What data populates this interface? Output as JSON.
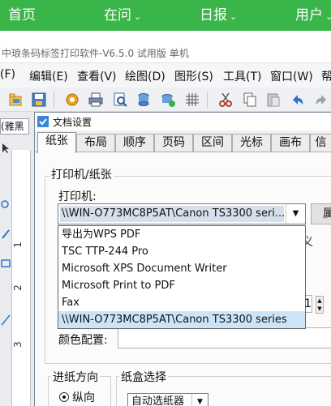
{
  "site_nav": {
    "items": [
      {
        "label": "首页",
        "has_dropdown": false
      },
      {
        "label": "在问",
        "has_dropdown": true
      },
      {
        "label": "日报",
        "has_dropdown": true
      },
      {
        "label": "用户",
        "has_dropdown": true
      }
    ],
    "chevron": "⌄",
    "background": "#39b54a"
  },
  "app": {
    "title": "中琅条码标签打印软件-V6.5.0 试用版 单机"
  },
  "menu": {
    "items": [
      {
        "label": "(F)"
      },
      {
        "label": "编辑(E)"
      },
      {
        "label": "查看(V)"
      },
      {
        "label": "绘图(D)"
      },
      {
        "label": "图形(S)"
      },
      {
        "label": "工具(T)"
      },
      {
        "label": "窗口(W)"
      },
      {
        "label": "帮"
      }
    ]
  },
  "toolbar": {
    "icons": [
      "open-icon",
      "save-icon",
      "settings-icon",
      "print-icon",
      "print-preview-icon",
      "database-icon",
      "data-link-icon",
      "grid-icon",
      "cut-icon",
      "copy-icon",
      "paste-icon",
      "undo-icon",
      "redo-icon"
    ]
  },
  "left_panel": {
    "font_name": "(雅黑",
    "ruler_numbers": [
      "1",
      "2",
      "3"
    ]
  },
  "dialog": {
    "title": "文档设置",
    "tabs": [
      {
        "label": "纸张",
        "active": true
      },
      {
        "label": "布局",
        "active": false
      },
      {
        "label": "顺序",
        "active": false
      },
      {
        "label": "页码",
        "active": false
      },
      {
        "label": "区间",
        "active": false
      },
      {
        "label": "光标",
        "active": false
      },
      {
        "label": "画布",
        "active": false
      },
      {
        "label": "信",
        "active": false
      }
    ],
    "printer_paper": {
      "group_label": "打印机/纸张",
      "printer_label": "打印机:",
      "printer_value": "\\\\WIN-O773MC8P5AT\\Canon TS3300 seri...",
      "side_button_label": "属",
      "partial_right_char": "义",
      "spin_value": "1",
      "color_config_label": "颜色配置:"
    },
    "printer_options": [
      {
        "label": "导出为WPS PDF",
        "selected": false
      },
      {
        "label": "TSC TTP-244 Pro",
        "selected": false
      },
      {
        "label": "Microsoft XPS Document Writer",
        "selected": false
      },
      {
        "label": "Microsoft Print to PDF",
        "selected": false
      },
      {
        "label": "Fax",
        "selected": false
      },
      {
        "label": "\\\\WIN-O773MC8P5AT\\Canon TS3300 series",
        "selected": true
      }
    ],
    "feed_direction": {
      "group_label": "进纸方向",
      "option_label": "纵向"
    },
    "paper_box": {
      "group_label": "纸盒选择",
      "value": "自动选纸器"
    }
  }
}
